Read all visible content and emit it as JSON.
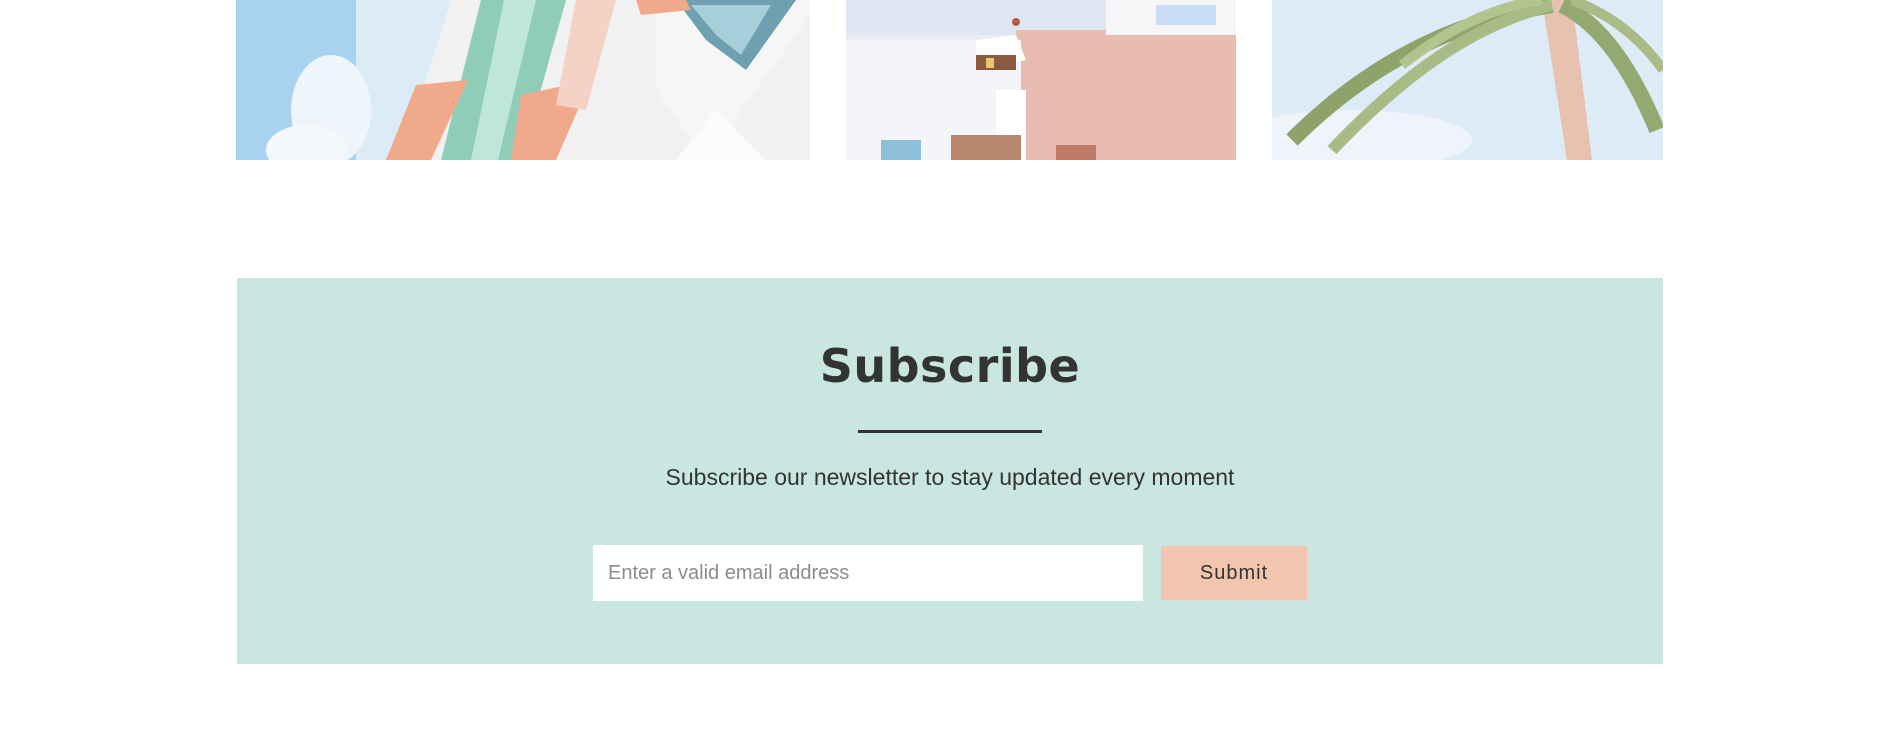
{
  "gallery": {
    "images": [
      {
        "name": "pastel-art-deco-building-photo"
      },
      {
        "name": "white-pink-building-photo"
      },
      {
        "name": "palm-tree-sky-photo"
      }
    ]
  },
  "subscribe": {
    "title": "Subscribe",
    "description": "Subscribe our newsletter to stay updated every moment",
    "email_placeholder": "Enter a valid email address",
    "email_value": "",
    "submit_label": "Submit"
  },
  "colors": {
    "panel_background": "#c9e7e0",
    "button_background": "#f2c5ae",
    "text": "#333333"
  }
}
